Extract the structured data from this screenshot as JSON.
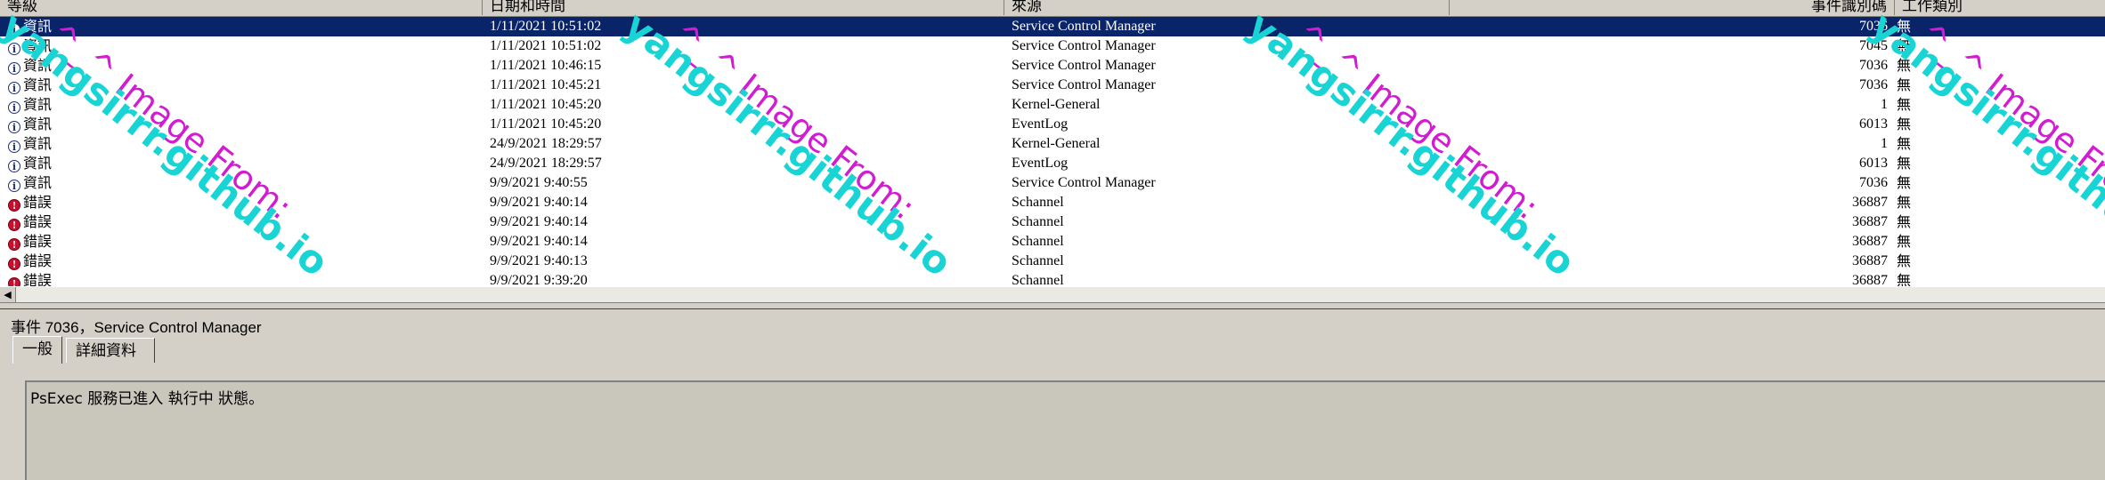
{
  "columns": {
    "level": "等級",
    "datetime": "日期和時間",
    "source": "來源",
    "event_id": "事件識別碼",
    "task_category": "工作類別"
  },
  "events": [
    {
      "level": "資訊",
      "level_icon": "info-icon",
      "datetime": "1/11/2021 10:51:02",
      "source": "Service Control Manager",
      "event_id": "7036",
      "task": "無",
      "selected": true
    },
    {
      "level": "資訊",
      "level_icon": "info-icon",
      "datetime": "1/11/2021 10:51:02",
      "source": "Service Control Manager",
      "event_id": "7045",
      "task": "無"
    },
    {
      "level": "資訊",
      "level_icon": "info-icon",
      "datetime": "1/11/2021 10:46:15",
      "source": "Service Control Manager",
      "event_id": "7036",
      "task": "無"
    },
    {
      "level": "資訊",
      "level_icon": "info-icon",
      "datetime": "1/11/2021 10:45:21",
      "source": "Service Control Manager",
      "event_id": "7036",
      "task": "無"
    },
    {
      "level": "資訊",
      "level_icon": "info-icon",
      "datetime": "1/11/2021 10:45:20",
      "source": "Kernel-General",
      "event_id": "1",
      "task": "無"
    },
    {
      "level": "資訊",
      "level_icon": "info-icon",
      "datetime": "1/11/2021 10:45:20",
      "source": "EventLog",
      "event_id": "6013",
      "task": "無"
    },
    {
      "level": "資訊",
      "level_icon": "info-icon",
      "datetime": "24/9/2021 18:29:57",
      "source": "Kernel-General",
      "event_id": "1",
      "task": "無"
    },
    {
      "level": "資訊",
      "level_icon": "info-icon",
      "datetime": "24/9/2021 18:29:57",
      "source": "EventLog",
      "event_id": "6013",
      "task": "無"
    },
    {
      "level": "資訊",
      "level_icon": "info-icon",
      "datetime": "9/9/2021 9:40:55",
      "source": "Service Control Manager",
      "event_id": "7036",
      "task": "無"
    },
    {
      "level": "錯誤",
      "level_icon": "error-icon",
      "datetime": "9/9/2021 9:40:14",
      "source": "Schannel",
      "event_id": "36887",
      "task": "無"
    },
    {
      "level": "錯誤",
      "level_icon": "error-icon",
      "datetime": "9/9/2021 9:40:14",
      "source": "Schannel",
      "event_id": "36887",
      "task": "無"
    },
    {
      "level": "錯誤",
      "level_icon": "error-icon",
      "datetime": "9/9/2021 9:40:14",
      "source": "Schannel",
      "event_id": "36887",
      "task": "無"
    },
    {
      "level": "錯誤",
      "level_icon": "error-icon",
      "datetime": "9/9/2021 9:40:13",
      "source": "Schannel",
      "event_id": "36887",
      "task": "無"
    },
    {
      "level": "錯誤",
      "level_icon": "error-icon",
      "datetime": "9/9/2021 9:39:20",
      "source": "Schannel",
      "event_id": "36887",
      "task": "無"
    }
  ],
  "detail": {
    "title": "事件 7036，Service Control Manager",
    "tabs": [
      "一般",
      "詳細資料"
    ],
    "message": "PsExec 服務已進入 執行中 狀態。"
  },
  "watermark": {
    "line1": "^_^ Image From:",
    "line2": "yangsirrr.github.io"
  },
  "colors": {
    "selection": "#0a246a",
    "watermark_magenta": "#d21cd2",
    "watermark_cyan": "#19d4d4",
    "error_icon": "#c8102e"
  },
  "scrollbar_left_arrow": "◀"
}
